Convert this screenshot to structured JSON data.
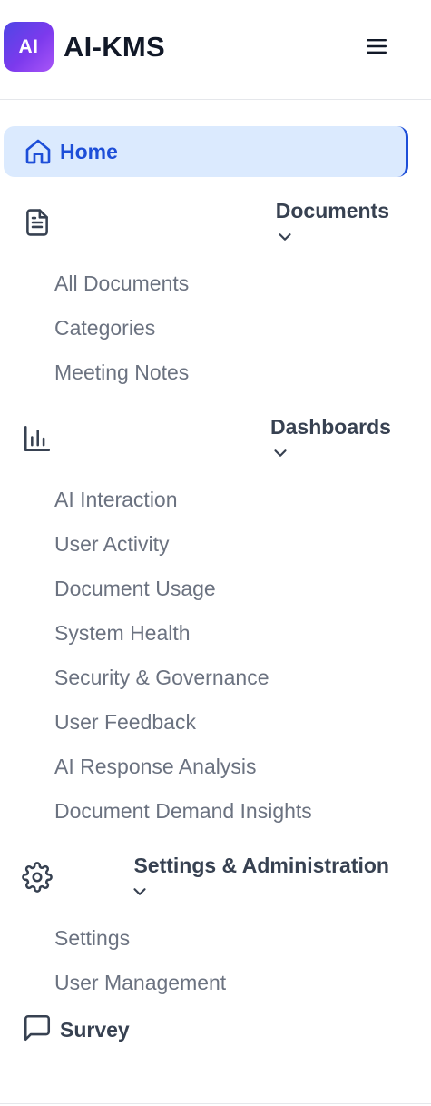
{
  "app": {
    "logo_text": "AI",
    "title": "AI-KMS",
    "brand_gradient": [
      "#4f46e5",
      "#a855f7"
    ]
  },
  "header": {
    "menu_icon": "hamburger-menu-icon"
  },
  "nav": {
    "home": {
      "label": "Home",
      "icon": "home-icon",
      "active": true,
      "active_color": "#1d4ed8",
      "active_bg": "#dbeafe"
    },
    "documents": {
      "label": "Documents",
      "icon": "document-icon",
      "items": [
        "All Documents",
        "Categories",
        "Meeting Notes"
      ]
    },
    "dashboards": {
      "label": "Dashboards",
      "icon": "bar-chart-icon",
      "items": [
        "AI Interaction",
        "User Activity",
        "Document Usage",
        "System Health",
        "Security & Governance",
        "User Feedback",
        "AI Response Analysis",
        "Document Demand Insights"
      ]
    },
    "settings": {
      "label": "Settings & Administration",
      "icon": "gear-icon",
      "items": [
        "Settings",
        "User Management"
      ]
    },
    "survey": {
      "label": "Survey",
      "icon": "chat-bubble-icon"
    }
  }
}
